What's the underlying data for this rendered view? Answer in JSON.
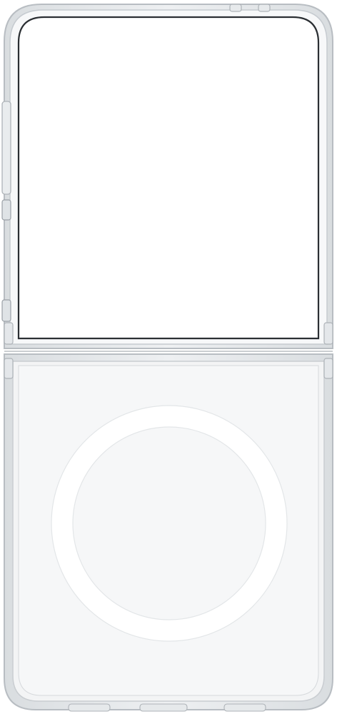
{
  "product": {
    "kind": "clear-flip-phone-case",
    "colors": {
      "background": "#ffffff",
      "case_edge": "#c9cdd1",
      "case_edge_dark": "#9aa0a6",
      "case_fill": "#f4f5f6",
      "panel_fill": "#ffffff",
      "ring": "#ffffff"
    }
  }
}
